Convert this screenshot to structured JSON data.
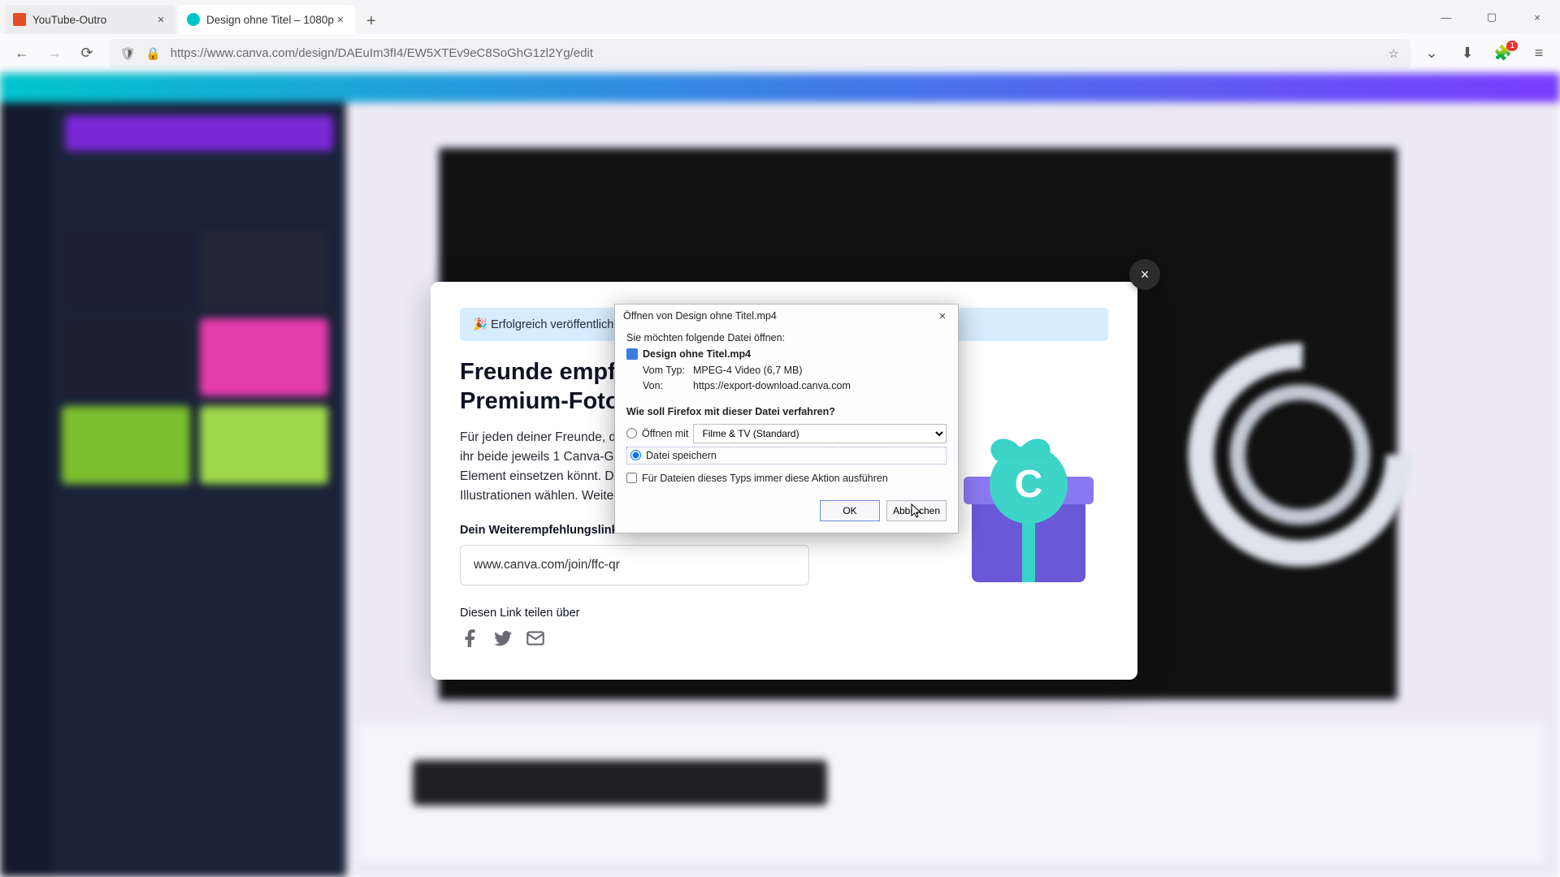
{
  "browser": {
    "tabs": [
      {
        "title": "YouTube-Outro"
      },
      {
        "title": "Design ohne Titel – 1080p"
      }
    ],
    "url": "https://www.canva.com/design/DAEuIm3fI4/EW5XTEv9eC8SoGhG1zl2Yg/edit",
    "ext_badge": "1"
  },
  "canva_modal": {
    "banner": "🎉 Erfolgreich veröffentlicht. F",
    "heading_l1": "Freunde empfe",
    "heading_l2": "Premium-Fotos.",
    "body": "Für jeden deiner Freunde, d\nihr beide jeweils 1 Canva-Gu\nElement einsetzen könnt. Du\nIllustrationen wählen. Weite",
    "ref_label": "Dein Weiterempfehlungslink:",
    "ref_value": "www.canva.com/join/ffc-qr",
    "share_label": "Diesen Link teilen über"
  },
  "ff_dialog": {
    "title": "Öffnen von Design ohne Titel.mp4",
    "intro": "Sie möchten folgende Datei öffnen:",
    "filename": "Design ohne Titel.mp4",
    "type_label": "Vom Typ:",
    "type_value": "MPEG-4 Video (6,7 MB)",
    "from_label": "Von:",
    "from_value": "https://export-download.canva.com",
    "question": "Wie soll Firefox mit dieser Datei verfahren?",
    "open_with": "Öffnen mit",
    "open_app": "Filme & TV (Standard)",
    "save_file": "Datei speichern",
    "always": "Für Dateien dieses Typs immer diese Aktion ausführen",
    "ok": "OK",
    "cancel": "Abbrechen"
  }
}
